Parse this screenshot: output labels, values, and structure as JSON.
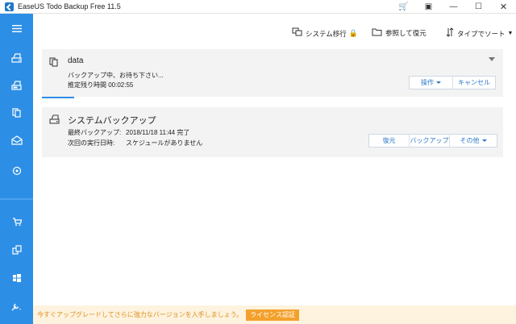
{
  "window": {
    "title": "EaseUS Todo Backup Free 11.5",
    "controls": {
      "cart": "🛒",
      "settings": "▣",
      "minimize": "—",
      "maximize": "☐",
      "close": "✕"
    }
  },
  "sidebar": {
    "items": [
      "menu-icon",
      "disk-backup-icon",
      "partition-backup-icon",
      "file-backup-icon",
      "mail-backup-icon",
      "smart-backup-icon",
      "cart-icon",
      "clone-icon",
      "windows-icon",
      "tools-icon"
    ]
  },
  "toolbar": {
    "system_migrate": "システム移行",
    "browse_restore": "参照して復元",
    "sort_by_type": "タイプでソート"
  },
  "tasks": [
    {
      "title": "data",
      "status": "バックアップ中、お待ち下さい...",
      "remaining_label": "推定残り時間",
      "remaining_value": "00:02:55",
      "buttons": {
        "operate": "操作",
        "cancel": "キャンセル"
      }
    },
    {
      "title": "システムバックアップ",
      "last_backup_label": "最終バックアップ:",
      "last_backup_value": "2018/11/18 11:44 完了",
      "next_run_label": "次回の実行日時:",
      "next_run_value": "スケジュールがありません",
      "buttons": {
        "restore": "復元",
        "backup": "バックアップ",
        "other": "その他"
      }
    }
  ],
  "promo": {
    "text": "今すぐアップグレードしてさらに強力なバージョンを入手しましょう。",
    "button": "ライセンス認証"
  },
  "colors": {
    "accent": "#2d8ee6",
    "promo": "#f3a12c",
    "card_bg": "#f3f3f3"
  }
}
